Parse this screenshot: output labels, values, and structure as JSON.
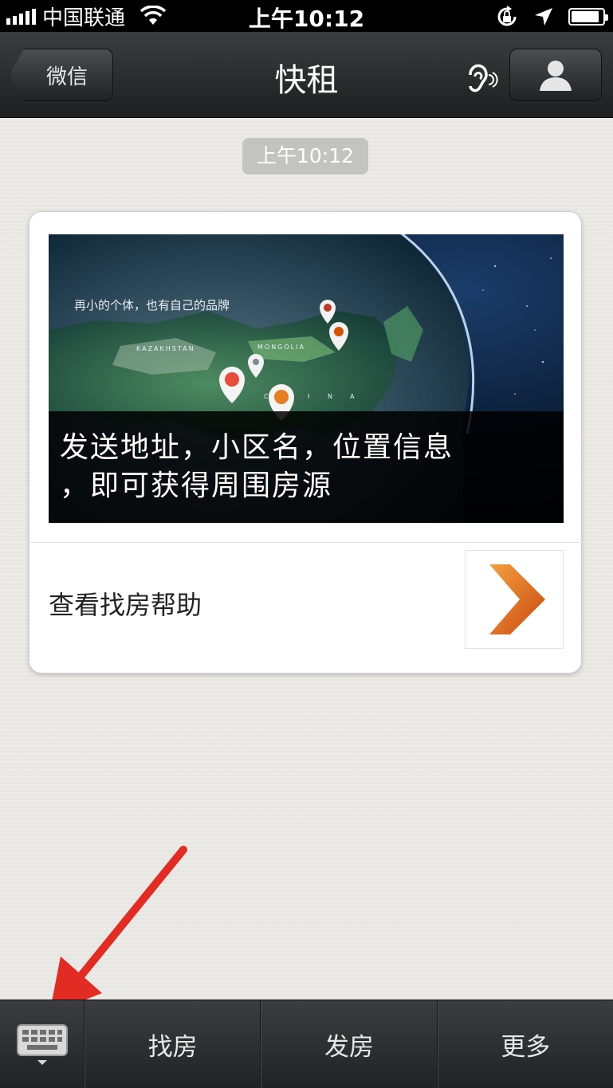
{
  "status_bar": {
    "carrier": "中国联通",
    "time": "上午10:12",
    "battery_level": 0.9
  },
  "nav_bar": {
    "back_label": "微信",
    "title": "快租"
  },
  "chat": {
    "timestamp": "上午10:12",
    "card": {
      "banner_tagline": "再小的个体，也有自己的品牌",
      "map_labels": [
        "KAZAKHSTAN",
        "MONGOLIA",
        "C",
        "H",
        "I",
        "N",
        "A"
      ],
      "banner_caption_line1": "发送地址，小区名，位置信息",
      "banner_caption_line2": "，即可获得周围房源",
      "help_link": "查看找房帮助"
    }
  },
  "bottom_menu": {
    "items": [
      {
        "label": "找房"
      },
      {
        "label": "发房"
      },
      {
        "label": "更多"
      }
    ]
  },
  "colors": {
    "accent_orange": "#e2661c",
    "annotation_red": "#e22b22",
    "nav_dark": "#1d1f20"
  }
}
